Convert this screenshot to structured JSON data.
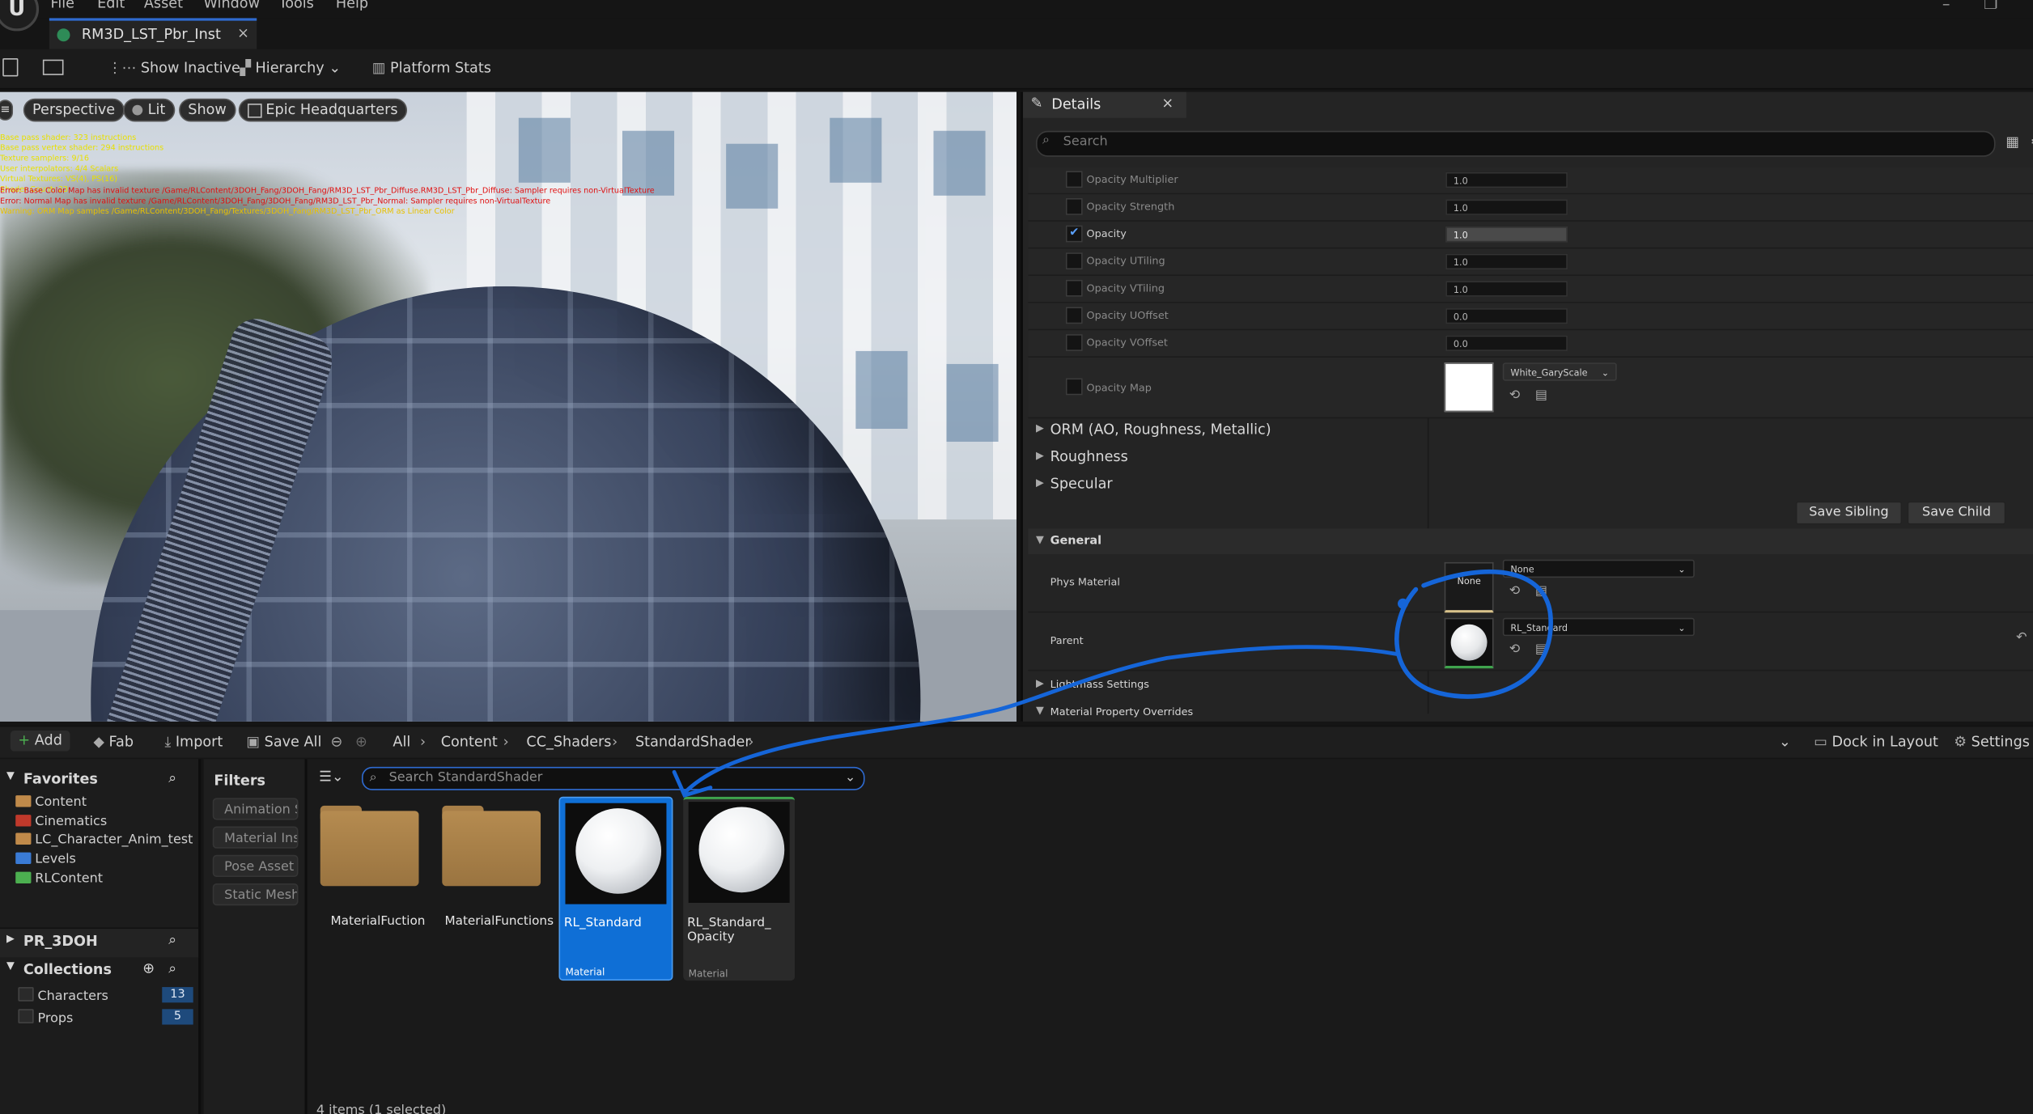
{
  "app": {
    "logo_text": "U",
    "menu": [
      "File",
      "Edit",
      "Asset",
      "Window",
      "Tools",
      "Help"
    ],
    "document_tab": "RM3D_LST_Pbr_Inst",
    "window_controls": [
      "–",
      "❐"
    ]
  },
  "toolbar": {
    "show_inactive": "Show Inactive",
    "hierarchy": "Hierarchy",
    "platform_stats": "Platform Stats"
  },
  "viewport": {
    "perspective": "Perspective",
    "lit": "Lit",
    "show": "Show",
    "environment": "Epic Headquarters",
    "stats_lines": [
      "Base pass shader: 323 instructions",
      "Base pass vertex shader: 294 instructions",
      "Texture samplers: 9/16",
      "User interpolators: 4/4 Scalars",
      "Virtual Textures: VS(4), PS(16)",
      "Shader Count: 23"
    ],
    "error_lines": [
      "Error: Base Color Map has invalid texture /Game/RLContent/3DOH_Fang/3DOH_Fang/RM3D_LST_Pbr_Diffuse.RM3D_LST_Pbr_Diffuse: Sampler requires non-VirtualTexture",
      "Error: Normal Map has invalid texture /Game/RLContent/3DOH_Fang/3DOH_Fang/RM3D_LST_Pbr_Normal: Sampler requires non-VirtualTexture",
      "Warning: ORM Map samples /Game/RLContent/3DOH_Fang/Textures/3DOH_Fang/RM3D_LST_Pbr_ORM as Linear Color"
    ]
  },
  "details": {
    "tab_label": "Details",
    "close": "×",
    "search_placeholder": "Search",
    "opacity_props": [
      {
        "label": "Opacity Multiplier",
        "value": "1.0",
        "checked": false
      },
      {
        "label": "Opacity Strength",
        "value": "1.0",
        "checked": false
      },
      {
        "label": "Opacity",
        "value": "1.0",
        "checked": true
      },
      {
        "label": "Opacity UTiling",
        "value": "1.0",
        "checked": false
      },
      {
        "label": "Opacity VTiling",
        "value": "1.0",
        "checked": false
      },
      {
        "label": "Opacity UOffset",
        "value": "0.0",
        "checked": false
      },
      {
        "label": "Opacity VOffset",
        "value": "0.0",
        "checked": false
      }
    ],
    "opacity_map": {
      "label": "Opacity Map",
      "texture": "White_GaryScale"
    },
    "sections": [
      "ORM (AO, Roughness, Metallic)",
      "Roughness",
      "Specular"
    ],
    "save_sibling": "Save Sibling",
    "save_child": "Save Child",
    "general": "General",
    "phys_material": {
      "label": "Phys Material",
      "thumb_text": "None",
      "value": "None"
    },
    "parent": {
      "label": "Parent",
      "value": "RL_Standard"
    },
    "lightmass": "Lightmass Settings",
    "material_overrides": "Material Property Overrides"
  },
  "content_browser": {
    "add": "Add",
    "fab": "Fab",
    "import": "Import",
    "save_all": "Save All",
    "breadcrumb": [
      "All",
      "Content",
      "CC_Shaders",
      "StandardShader"
    ],
    "dock_in_layout": "Dock in Layout",
    "settings": "Settings",
    "favorites": "Favorites",
    "favorite_items": [
      {
        "label": "Content",
        "color": "#c08a4a"
      },
      {
        "label": "Cinematics",
        "color": "#c0392b"
      },
      {
        "label": "LC_Character_Anim_test",
        "color": "#c08a4a"
      },
      {
        "label": "Levels",
        "color": "#3a7bd5"
      },
      {
        "label": "RLContent",
        "color": "#4caf50"
      }
    ],
    "project": "PR_3DOH",
    "collections": "Collections",
    "collection_items": [
      {
        "label": "Characters",
        "count": "13"
      },
      {
        "label": "Props",
        "count": "5"
      }
    ],
    "filters": "Filters",
    "filter_chips": [
      "Animation S",
      "Material Ins",
      "Pose Asset",
      "Static Mesh"
    ],
    "search_placeholder": "Search StandardShader",
    "assets": [
      {
        "name": "MaterialFuction",
        "kind": "folder"
      },
      {
        "name": "MaterialFunctions",
        "kind": "folder"
      },
      {
        "name": "RL_Standard",
        "kind": "material",
        "type": "Material",
        "selected": true
      },
      {
        "name": "RL_Standard_\nOpacity",
        "kind": "material",
        "type": "Material",
        "selected": false
      }
    ],
    "status": "4 items (1 selected)"
  },
  "colors": {
    "accent": "#2f6bd1",
    "selected": "#0f6fd6",
    "annotation": "#1565d8"
  }
}
